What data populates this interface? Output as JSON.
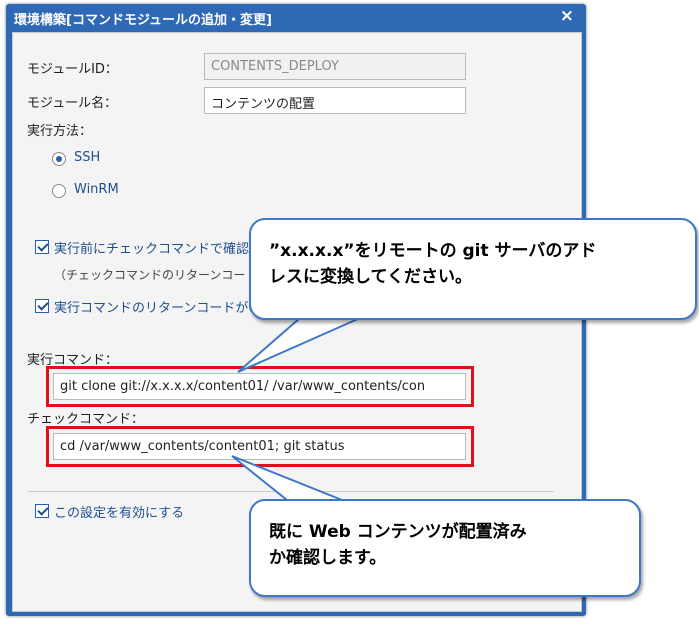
{
  "dialog": {
    "title": "環境構築[コマンドモジュールの追加・変更]",
    "close_icon": "×"
  },
  "form": {
    "module_id_label": "モジュールID：",
    "module_id_value": "CONTENTS_DEPLOY",
    "module_name_label": "モジュール名：",
    "module_name_value": "コンテンツの配置",
    "exec_method_label": "実行方法：",
    "radios": [
      {
        "label": "SSH",
        "selected": true
      },
      {
        "label": "WinRM",
        "selected": false
      }
    ],
    "precheck_checkbox_label": "実行前にチェックコマンドで確認する",
    "precheck_hint": "（チェックコマンドのリターンコードが0",
    "return_code_checkbox_label": "実行コマンドのリターンコードが0",
    "exec_command_label": "実行コマンド：",
    "exec_command_value": "git clone git://x.x.x.x/content01/ /var/www_contents/con",
    "check_command_label": "チェックコマンド：",
    "check_command_value": "cd /var/www_contents/content01; git status",
    "enable_checkbox_label": "この設定を有効にする"
  },
  "callouts": {
    "top_line1": "”x.x.x.x”をリモートの git サーバのアド",
    "top_line2": "レスに変換してください。",
    "bottom_line1": "既に Web コンテンツが配置済み",
    "bottom_line2": "か確認します。"
  },
  "colors": {
    "titlebar": "#2f68b4",
    "highlight_border": "#e0101a",
    "callout_border": "#3d77c9"
  }
}
